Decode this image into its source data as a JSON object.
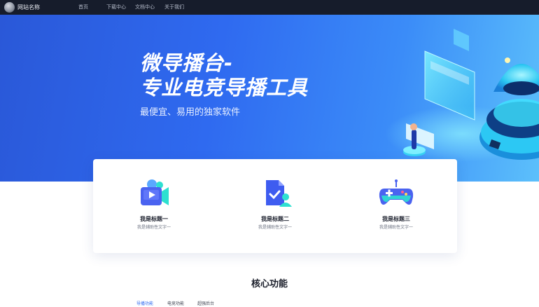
{
  "header": {
    "site_name": "网站名称",
    "nav": [
      "首页",
      "下载中心",
      "文档中心",
      "关于我们"
    ]
  },
  "hero": {
    "title_line1": "微导播台-",
    "title_line2": "专业电竞导播工具",
    "subtitle": "最便宜、易用的独家软件"
  },
  "features": [
    {
      "title": "我是标题一",
      "subtitle": "我是辅助性文字一",
      "icon": "video-camera-icon"
    },
    {
      "title": "我是标题二",
      "subtitle": "我是辅助性文字一",
      "icon": "document-user-icon"
    },
    {
      "title": "我是标题三",
      "subtitle": "我是辅助性文字一",
      "icon": "gamepad-icon"
    }
  ],
  "core": {
    "title": "核心功能",
    "tabs": [
      "导播功能",
      "电竞功能",
      "超强后台"
    ],
    "active_tab": 0
  },
  "colors": {
    "nav_bg": "#161c2b",
    "hero_start": "#2a58d8",
    "hero_end": "#5cc0fb",
    "accent": "#2f6af0"
  }
}
